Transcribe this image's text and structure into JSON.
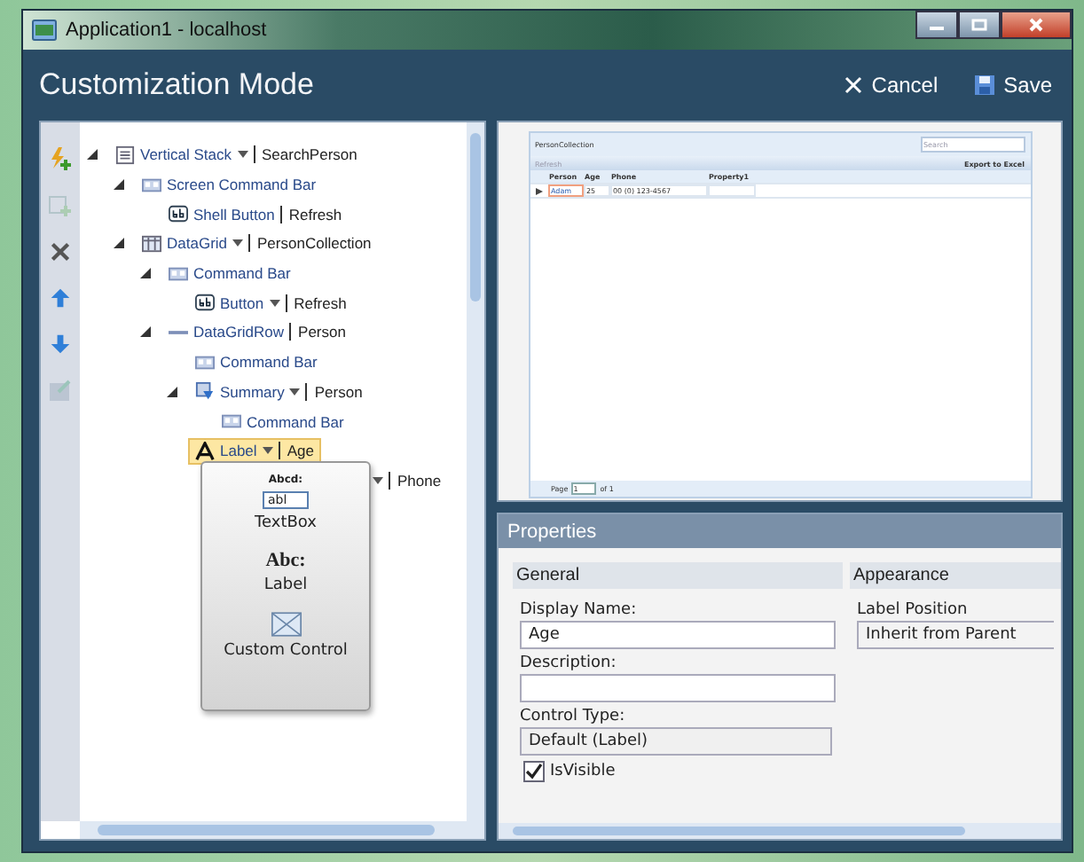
{
  "window": {
    "title": "Application1 - localhost"
  },
  "header": {
    "title": "Customization Mode",
    "actions": [
      {
        "label": "Cancel"
      },
      {
        "label": "Save"
      }
    ]
  },
  "toolbar": [
    {
      "kind": "add",
      "disabled": false
    },
    {
      "kind": "add-item",
      "disabled": true
    },
    {
      "kind": "delete",
      "disabled": false
    },
    {
      "kind": "up",
      "disabled": false
    },
    {
      "kind": "down",
      "disabled": false
    },
    {
      "kind": "edit",
      "disabled": true
    }
  ],
  "tree": [
    {
      "kind": "stack",
      "label": "Vertical Stack",
      "dropdown": true,
      "binding": "SearchPerson",
      "expanded": true,
      "selected": false,
      "children": [
        {
          "kind": "commandbar",
          "label": "Screen Command Bar",
          "dropdown": false,
          "expanded": true,
          "selected": false,
          "children": [
            {
              "kind": "button",
              "label": "Shell Button",
              "dropdown": false,
              "binding": "Refresh",
              "expanded": false,
              "selected": false
            }
          ]
        },
        {
          "kind": "grid",
          "label": "DataGrid",
          "dropdown": true,
          "binding": "PersonCollection",
          "expanded": true,
          "selected": false,
          "children": [
            {
              "kind": "commandbar",
              "label": "Command Bar",
              "dropdown": false,
              "expanded": true,
              "selected": false,
              "children": [
                {
                  "kind": "button",
                  "label": "Button",
                  "dropdown": true,
                  "binding": "Refresh",
                  "expanded": false,
                  "selected": false
                }
              ]
            },
            {
              "kind": "row",
              "label": "DataGridRow",
              "dropdown": false,
              "binding": "Person",
              "expanded": true,
              "selected": false,
              "children": [
                {
                  "kind": "commandbar",
                  "label": "Command Bar",
                  "dropdown": false,
                  "expanded": false,
                  "selected": false
                },
                {
                  "kind": "summary",
                  "label": "Summary",
                  "dropdown": true,
                  "binding": "Person",
                  "expanded": true,
                  "selected": false,
                  "children": [
                    {
                      "kind": "commandbar",
                      "label": "Command Bar",
                      "dropdown": false,
                      "expanded": false,
                      "selected": false
                    }
                  ]
                },
                {
                  "kind": "label",
                  "label": "Label",
                  "dropdown": true,
                  "binding": "Age",
                  "expanded": false,
                  "selected": true
                },
                {
                  "kind": "covered",
                  "dropdown": true,
                  "binding": "Phone",
                  "expanded": false,
                  "selected": false
                }
              ]
            }
          ]
        }
      ]
    }
  ],
  "popup": {
    "options": [
      {
        "kind": "textbox",
        "sample_label": "Abcd:",
        "sample_value": "abl",
        "label": "TextBox"
      },
      {
        "kind": "label",
        "sample": "Abc:",
        "label": "Label"
      },
      {
        "kind": "custom",
        "label": "Custom Control"
      }
    ]
  },
  "preview": {
    "title": "PersonCollection",
    "search_placeholder": "Search",
    "command": {
      "label": "Refresh",
      "disabled": true
    },
    "export": "Export to Excel",
    "columns": [
      "Person",
      "Age",
      "Phone",
      "Property1"
    ],
    "rows": [
      [
        "Adam",
        "25",
        "00 (0) 123-4567"
      ]
    ],
    "pager": {
      "page_label": "Page",
      "page": "1",
      "of": "of 1"
    }
  },
  "properties": {
    "title": "Properties",
    "sections": [
      {
        "title": "General",
        "fields": [
          {
            "kind": "text",
            "label": "Display Name:",
            "value": "Age"
          },
          {
            "kind": "text",
            "label": "Description:"
          },
          {
            "kind": "readonly",
            "label": "Control Type:",
            "value": "Default (Label)"
          },
          {
            "kind": "checkbox",
            "label": "IsVisible",
            "checked": true
          }
        ]
      },
      {
        "title": "Appearance",
        "fields": [
          {
            "kind": "readonly",
            "label": "Label Position",
            "value": "Inherit from Parent"
          }
        ]
      }
    ]
  }
}
